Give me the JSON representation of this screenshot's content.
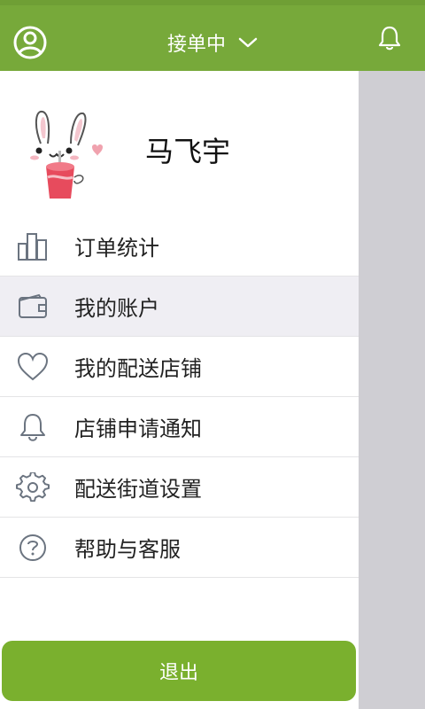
{
  "header": {
    "title": "接单中",
    "icons": {
      "user": "user-circle-icon",
      "dropdown": "chevron-down-icon",
      "bell": "bell-icon"
    }
  },
  "profile": {
    "name": "马飞宇",
    "avatar": "bunny-avatar"
  },
  "menu": {
    "items": [
      {
        "label": "订单统计",
        "icon": "bar-chart-icon"
      },
      {
        "label": "我的账户",
        "icon": "wallet-icon"
      },
      {
        "label": "我的配送店铺",
        "icon": "heart-icon"
      },
      {
        "label": "店铺申请通知",
        "icon": "bell-icon"
      },
      {
        "label": "配送街道设置",
        "icon": "gear-icon"
      },
      {
        "label": "帮助与客服",
        "icon": "help-icon"
      }
    ]
  },
  "logout_label": "退出",
  "colors": {
    "accent": "#77a93a",
    "logout": "#7ab02e",
    "overlay": "#cfced3"
  }
}
